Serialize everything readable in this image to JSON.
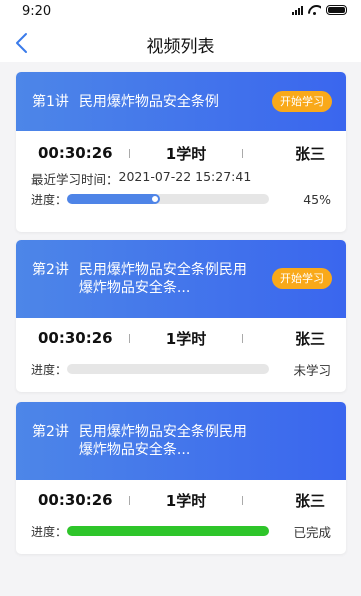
{
  "status_bar": {
    "time": "9:20",
    "icons": [
      "signal-icon",
      "wifi-icon",
      "battery-icon"
    ]
  },
  "nav": {
    "title": "视频列表",
    "back_icon": "chevron-left-icon"
  },
  "colors": {
    "header_gradient_start": "#4d86e8",
    "header_gradient_end": "#3a66ee",
    "start_button": "#f9a91a",
    "progress_blue": "#4e84e7",
    "progress_green": "#2ec52a",
    "progress_track": "#e6e6e6"
  },
  "videos": [
    {
      "lesson_no": "第1讲",
      "title": "民用爆炸物品安全条例",
      "start_label": "开始学习",
      "duration": "00:30:26",
      "hours": "1学时",
      "teacher": "张三",
      "last_study_label": "最近学习时间：",
      "last_study_time": "2021-07-22  15:27:41",
      "progress_label": "进度：",
      "progress_fraction": 0.45,
      "progress_text": "45%"
    },
    {
      "lesson_no": "第2讲",
      "title": "民用爆炸物品安全条例民用爆炸物品安全条...",
      "start_label": "开始学习",
      "duration": "00:30:26",
      "hours": "1学时",
      "teacher": "张三",
      "progress_label": "进度：",
      "progress_fraction": 0,
      "progress_text": "未学习"
    },
    {
      "lesson_no": "第2讲",
      "title": "民用爆炸物品安全条例民用爆炸物品安全条...",
      "duration": "00:30:26",
      "hours": "1学时",
      "teacher": "张三",
      "progress_label": "进度：",
      "progress_fraction": 1,
      "progress_text": "已完成"
    }
  ]
}
